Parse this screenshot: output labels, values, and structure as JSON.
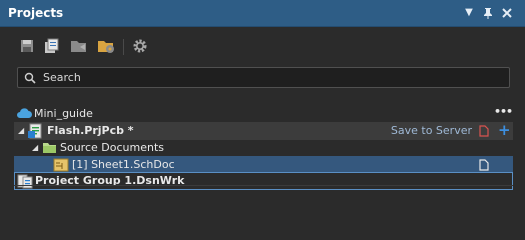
{
  "panel": {
    "title": "Projects"
  },
  "search": {
    "placeholder": "Search"
  },
  "tree": {
    "workspace": {
      "label": "Mini_guide",
      "more": "•••"
    },
    "project": {
      "label": "Flash.PrjPcb *",
      "save_label": "Save to Server",
      "add_symbol": "+"
    },
    "folder": {
      "label": "Source Documents"
    },
    "document": {
      "label": "[1] Sheet1.SchDoc"
    },
    "group": {
      "label": "Project Group 1.DsnWrk"
    }
  },
  "colors": {
    "titlebar": "#2e5d86",
    "selection": "#35587e",
    "save_link": "#9fb9d6",
    "add_icon": "#3d8fe0",
    "unsaved_doc_icon": "#d9534f"
  }
}
